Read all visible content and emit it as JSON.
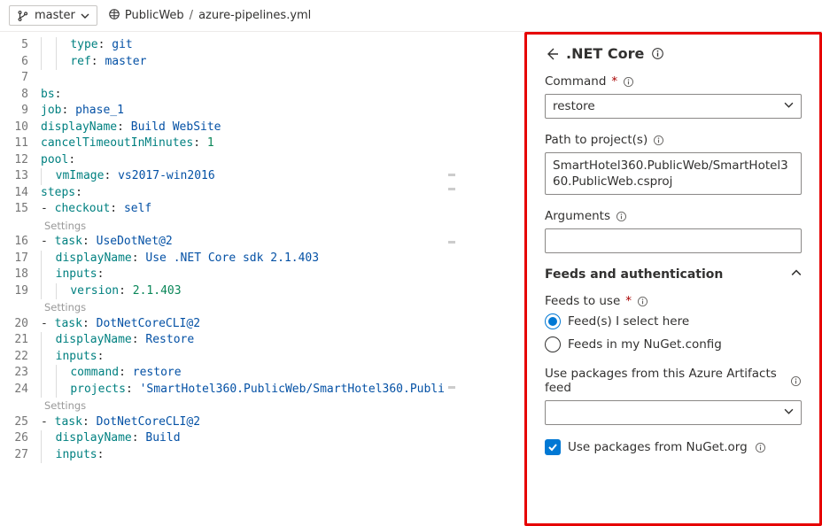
{
  "topbar": {
    "branch": "master",
    "breadcrumb": {
      "repo": "PublicWeb",
      "file": "azure-pipelines.yml"
    }
  },
  "editor": {
    "lens_text": "Settings",
    "lines": [
      {
        "ln": 5,
        "indent": 2,
        "parts": [
          [
            "key",
            "type"
          ],
          [
            "punc",
            ": "
          ],
          [
            "ident",
            "git"
          ]
        ]
      },
      {
        "ln": 6,
        "indent": 2,
        "parts": [
          [
            "key",
            "ref"
          ],
          [
            "punc",
            ": "
          ],
          [
            "ident",
            "master"
          ]
        ]
      },
      {
        "ln": 7,
        "indent": 0,
        "parts": []
      },
      {
        "ln": 8,
        "indent": 0,
        "parts": [
          [
            "key",
            "bs"
          ],
          [
            "punc",
            ":"
          ]
        ]
      },
      {
        "ln": 9,
        "indent": 0,
        "parts": [
          [
            "key",
            "job"
          ],
          [
            "punc",
            ": "
          ],
          [
            "ident",
            "phase_1"
          ]
        ]
      },
      {
        "ln": 10,
        "indent": 0,
        "parts": [
          [
            "key",
            "displayName"
          ],
          [
            "punc",
            ": "
          ],
          [
            "ident",
            "Build WebSite"
          ]
        ]
      },
      {
        "ln": 11,
        "indent": 0,
        "parts": [
          [
            "key",
            "cancelTimeoutInMinutes"
          ],
          [
            "punc",
            ": "
          ],
          [
            "num",
            "1"
          ]
        ]
      },
      {
        "ln": 12,
        "indent": 0,
        "parts": [
          [
            "key",
            "pool"
          ],
          [
            "punc",
            ":"
          ]
        ]
      },
      {
        "ln": 13,
        "indent": 1,
        "parts": [
          [
            "key",
            "vmImage"
          ],
          [
            "punc",
            ": "
          ],
          [
            "ident",
            "vs2017-win2016"
          ]
        ]
      },
      {
        "ln": 14,
        "indent": 0,
        "parts": [
          [
            "key",
            "steps"
          ],
          [
            "punc",
            ":"
          ]
        ]
      },
      {
        "ln": 15,
        "indent": 0,
        "parts": [
          [
            "punc",
            "- "
          ],
          [
            "key",
            "checkout"
          ],
          [
            "punc",
            ": "
          ],
          [
            "ident",
            "self"
          ]
        ]
      },
      {
        "lens": true
      },
      {
        "ln": 16,
        "indent": 0,
        "parts": [
          [
            "punc",
            "- "
          ],
          [
            "key",
            "task"
          ],
          [
            "punc",
            ": "
          ],
          [
            "ident",
            "UseDotNet@2"
          ]
        ]
      },
      {
        "ln": 17,
        "indent": 1,
        "parts": [
          [
            "key",
            "displayName"
          ],
          [
            "punc",
            ": "
          ],
          [
            "ident",
            "Use .NET Core sdk 2.1.403"
          ]
        ]
      },
      {
        "ln": 18,
        "indent": 1,
        "parts": [
          [
            "key",
            "inputs"
          ],
          [
            "punc",
            ":"
          ]
        ]
      },
      {
        "ln": 19,
        "indent": 2,
        "parts": [
          [
            "key",
            "version"
          ],
          [
            "punc",
            ": "
          ],
          [
            "num",
            "2.1.403"
          ]
        ]
      },
      {
        "lens": true
      },
      {
        "ln": 20,
        "indent": 0,
        "parts": [
          [
            "punc",
            "- "
          ],
          [
            "key",
            "task"
          ],
          [
            "punc",
            ": "
          ],
          [
            "ident",
            "DotNetCoreCLI@2"
          ]
        ]
      },
      {
        "ln": 21,
        "indent": 1,
        "parts": [
          [
            "key",
            "displayName"
          ],
          [
            "punc",
            ": "
          ],
          [
            "ident",
            "Restore"
          ]
        ]
      },
      {
        "ln": 22,
        "indent": 1,
        "parts": [
          [
            "key",
            "inputs"
          ],
          [
            "punc",
            ":"
          ]
        ]
      },
      {
        "ln": 23,
        "indent": 2,
        "parts": [
          [
            "key",
            "command"
          ],
          [
            "punc",
            ": "
          ],
          [
            "ident",
            "restore"
          ]
        ]
      },
      {
        "ln": 24,
        "indent": 2,
        "parts": [
          [
            "key",
            "projects"
          ],
          [
            "punc",
            ": "
          ],
          [
            "str",
            "'SmartHotel360.PublicWeb/SmartHotel360.Publi"
          ]
        ]
      },
      {
        "lens": true
      },
      {
        "ln": 25,
        "indent": 0,
        "parts": [
          [
            "punc",
            "- "
          ],
          [
            "key",
            "task"
          ],
          [
            "punc",
            ": "
          ],
          [
            "ident",
            "DotNetCoreCLI@2"
          ]
        ]
      },
      {
        "ln": 26,
        "indent": 1,
        "parts": [
          [
            "key",
            "displayName"
          ],
          [
            "punc",
            ": "
          ],
          [
            "ident",
            "Build"
          ]
        ]
      },
      {
        "ln": 27,
        "indent": 1,
        "parts": [
          [
            "key",
            "inputs"
          ],
          [
            "punc",
            ":"
          ]
        ]
      }
    ]
  },
  "panel": {
    "title": ".NET Core",
    "command": {
      "label": "Command",
      "value": "restore"
    },
    "path": {
      "label": "Path to project(s)",
      "value": "SmartHotel360.PublicWeb/SmartHotel360.PublicWeb.csproj"
    },
    "args": {
      "label": "Arguments",
      "value": ""
    },
    "section": "Feeds and authentication",
    "feeds": {
      "label": "Feeds to use",
      "opt1": "Feed(s) I select here",
      "opt2": "Feeds in my NuGet.config"
    },
    "artifacts": {
      "label": "Use packages from this Azure Artifacts feed",
      "value": ""
    },
    "nuget": {
      "label": "Use packages from NuGet.org",
      "checked": true
    }
  }
}
